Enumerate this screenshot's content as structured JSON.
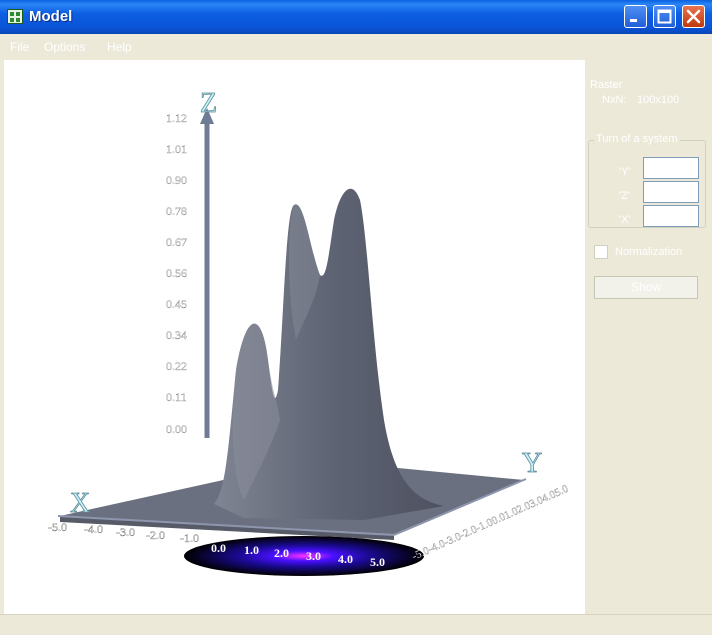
{
  "window": {
    "title": "Model"
  },
  "menu": {
    "file": "File",
    "options": "Options",
    "help": "Help"
  },
  "panel": {
    "raster_label": "Raster",
    "nxn_label": "NxN:",
    "nxn_value": "100x100",
    "group_title": "Turn of a system",
    "y_label": "'Y'",
    "z_label": "'Z'",
    "x_label": "'X'",
    "y_value": "",
    "z_value": "",
    "x_value": "",
    "normalization_label": "Normalization",
    "normalization_checked": false,
    "show_button": "Show"
  },
  "plot": {
    "z_axis_letter": "Z",
    "x_axis_letter": "X",
    "y_axis_letter": "Y",
    "z_ticks": [
      "1.12",
      "1.01",
      "0.90",
      "0.78",
      "0.67",
      "0.56",
      "0.45",
      "0.34",
      "0.22",
      "0.11",
      "0.00"
    ],
    "x_ticks": [
      "-5.0",
      "-4.0",
      "-3.0",
      "-2.0",
      "-1.0",
      "0.0",
      "1.0",
      "2.0",
      "3.0",
      "4.0",
      "5.0"
    ],
    "y_ticks_text": "-5.0-4.0-3.0-2.0-1.00.01.02.03.04.05.0",
    "surface_color": "#6b7080",
    "axis_color": "#6f7c96"
  }
}
